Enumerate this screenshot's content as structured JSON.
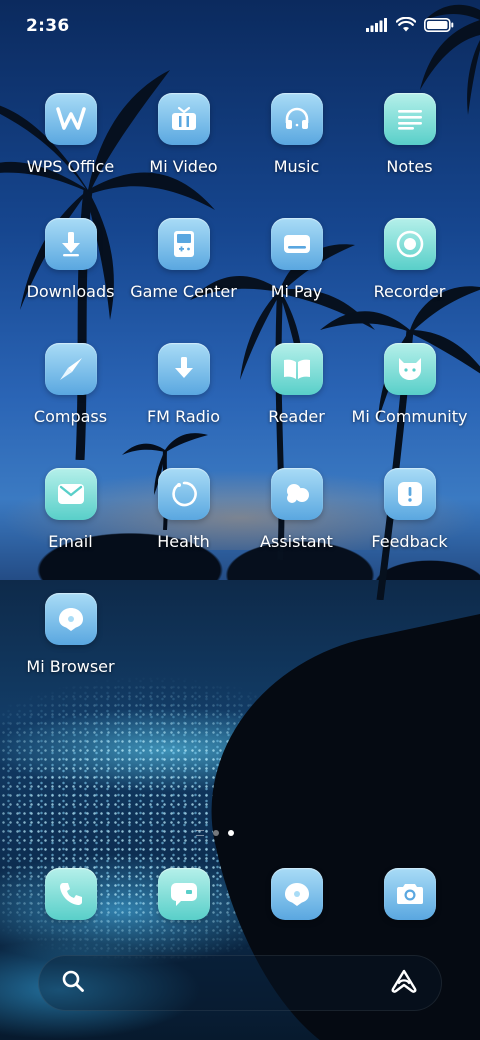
{
  "status_bar": {
    "time": "2:36",
    "icons": [
      "signal-icon",
      "wifi-icon",
      "battery-icon"
    ]
  },
  "apps": [
    {
      "label": "WPS Office",
      "icon": "wps-office-icon"
    },
    {
      "label": "Mi Video",
      "icon": "mi-video-icon"
    },
    {
      "label": "Music",
      "icon": "headphones-icon"
    },
    {
      "label": "Notes",
      "icon": "notes-icon"
    },
    {
      "label": "Downloads",
      "icon": "download-arrow-icon"
    },
    {
      "label": "Game Center",
      "icon": "gamepad-icon"
    },
    {
      "label": "Mi Pay",
      "icon": "card-icon"
    },
    {
      "label": "Recorder",
      "icon": "record-icon"
    },
    {
      "label": "Compass",
      "icon": "compass-needle-icon"
    },
    {
      "label": "FM Radio",
      "icon": "radio-icon"
    },
    {
      "label": "Reader",
      "icon": "book-icon"
    },
    {
      "label": "Mi Community",
      "icon": "community-icon"
    },
    {
      "label": "Email",
      "icon": "envelope-icon"
    },
    {
      "label": "Health",
      "icon": "health-ring-icon"
    },
    {
      "label": "Assistant",
      "icon": "assistant-cloud-icon"
    },
    {
      "label": "Feedback",
      "icon": "feedback-icon"
    },
    {
      "label": "Mi Browser",
      "icon": "browser-icon"
    }
  ],
  "page_indicator": {
    "pages": 2,
    "active_index": 1
  },
  "dock": [
    {
      "name": "phone",
      "icon": "phone-icon"
    },
    {
      "name": "messaging",
      "icon": "message-icon"
    },
    {
      "name": "browser",
      "icon": "browser-icon"
    },
    {
      "name": "camera",
      "icon": "camera-icon"
    }
  ],
  "search_bar": {
    "left_icon": "search-icon",
    "right_icon": "ai-assistant-icon"
  },
  "colors": {
    "icon_blue_top": "#a9dcf6",
    "icon_blue_bottom": "#5aa7e0",
    "icon_teal_top": "#b5f0ea",
    "icon_teal_bottom": "#59cfc9"
  }
}
